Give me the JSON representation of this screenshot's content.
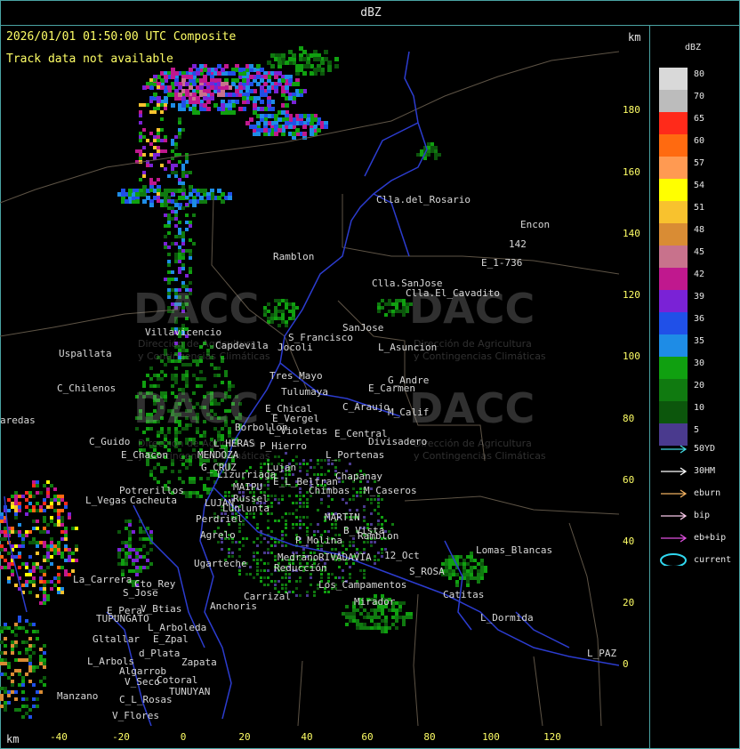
{
  "window": {
    "title": "dBZ"
  },
  "map": {
    "header": "2026/01/01 01:50:00 UTC Composite",
    "track_note": "Track data not available",
    "unit_top": "km",
    "unit_bottom": "km",
    "y_ticks": [
      "180",
      "160",
      "140",
      "120",
      "100",
      "80",
      "60",
      "40",
      "20",
      "0"
    ],
    "x_ticks": [
      "-40",
      "-20",
      "0",
      "20",
      "40",
      "60",
      "80",
      "100",
      "120"
    ],
    "places": [
      {
        "name": "Clla.del_Rosario"
      },
      {
        "name": "Encon"
      },
      {
        "name": "142"
      },
      {
        "name": "E_1-736"
      },
      {
        "name": "Ramblon"
      },
      {
        "name": "Clla.SanJose"
      },
      {
        "name": "Clla.El_Cavadito"
      },
      {
        "name": "SanJose"
      },
      {
        "name": "Villavicencio"
      },
      {
        "name": "Capdevila"
      },
      {
        "name": "S_Francisco"
      },
      {
        "name": "L_Asuncion"
      },
      {
        "name": "Uspallata"
      },
      {
        "name": "Jocoli"
      },
      {
        "name": "Tres_Mayo"
      },
      {
        "name": "G_Andre"
      },
      {
        "name": "C_Chilenos"
      },
      {
        "name": "Tulumaya"
      },
      {
        "name": "E_Carmen"
      },
      {
        "name": "E_Chical"
      },
      {
        "name": "C_Araujo"
      },
      {
        "name": "M_Calif"
      },
      {
        "name": "E_Vergel"
      },
      {
        "name": "aredas"
      },
      {
        "name": "Borbollon"
      },
      {
        "name": "L_Violetas"
      },
      {
        "name": "E_Central"
      },
      {
        "name": "Divisadero"
      },
      {
        "name": "C_Guido"
      },
      {
        "name": "L_HERAS"
      },
      {
        "name": "P_Hierro"
      },
      {
        "name": "E_Chacon"
      },
      {
        "name": "MENDOZA"
      },
      {
        "name": "L_Portenas"
      },
      {
        "name": "G_CRUZ"
      },
      {
        "name": "Lujan"
      },
      {
        "name": "Lizurriaga"
      },
      {
        "name": "Chapanay"
      },
      {
        "name": "E_L_Beltran"
      },
      {
        "name": "Chimbas"
      },
      {
        "name": "MAIPU"
      },
      {
        "name": "M_Caseros"
      },
      {
        "name": "Potrerillos"
      },
      {
        "name": "L_Vegas"
      },
      {
        "name": "Cacheuta"
      },
      {
        "name": "Russel"
      },
      {
        "name": "LUJAN"
      },
      {
        "name": "Lunlunta"
      },
      {
        "name": "MARTIN"
      },
      {
        "name": "Perdriel"
      },
      {
        "name": "B_Vista"
      },
      {
        "name": "Agrelo"
      },
      {
        "name": "Ramblon"
      },
      {
        "name": "P_Molina"
      },
      {
        "name": "Lomas_Blancas"
      },
      {
        "name": "Ugarteche"
      },
      {
        "name": "RIVADAVIA"
      },
      {
        "name": "12_Oct"
      },
      {
        "name": "Medrano"
      },
      {
        "name": "S_ROSA"
      },
      {
        "name": "Reducción"
      },
      {
        "name": "Catitas"
      },
      {
        "name": "La_Carrera"
      },
      {
        "name": "Cto_Rey"
      },
      {
        "name": "Los_Campamentos"
      },
      {
        "name": "S_Jose"
      },
      {
        "name": "Carrizal"
      },
      {
        "name": "Mirador"
      },
      {
        "name": "Anchoris"
      },
      {
        "name": "E_Pera"
      },
      {
        "name": "V_Btias"
      },
      {
        "name": "TUPUNGATO"
      },
      {
        "name": "L_Dormida"
      },
      {
        "name": "L_Arboleda"
      },
      {
        "name": "Gltallar"
      },
      {
        "name": "E_Zpal"
      },
      {
        "name": "L_PAZ"
      },
      {
        "name": "d_Plata"
      },
      {
        "name": "L_Arbols"
      },
      {
        "name": "Zapata"
      },
      {
        "name": "Algarrob"
      },
      {
        "name": "V_Seco"
      },
      {
        "name": "Cotoral"
      },
      {
        "name": "TUNUYAN"
      },
      {
        "name": "Manzano"
      },
      {
        "name": "C_L_Rosas"
      },
      {
        "name": "V_Flores"
      }
    ],
    "watermark": {
      "brand": "DACC",
      "line1": "Dirección de Agricultura",
      "line2": "y Contingencias Climáticas"
    }
  },
  "legend": {
    "title": "dBZ",
    "levels": [
      {
        "label": "80",
        "color": "#d9d9d9"
      },
      {
        "label": "70",
        "color": "#bcbcbc"
      },
      {
        "label": "65",
        "color": "#ff2a1a"
      },
      {
        "label": "60",
        "color": "#ff6a10"
      },
      {
        "label": "57",
        "color": "#ff9a52"
      },
      {
        "label": "54",
        "color": "#ffff00"
      },
      {
        "label": "51",
        "color": "#f8c22e"
      },
      {
        "label": "48",
        "color": "#d98c34"
      },
      {
        "label": "45",
        "color": "#c8728c"
      },
      {
        "label": "42",
        "color": "#c0188e"
      },
      {
        "label": "39",
        "color": "#7a22d6"
      },
      {
        "label": "36",
        "color": "#2050e8"
      },
      {
        "label": "35",
        "color": "#1e8ce6"
      },
      {
        "label": "30",
        "color": "#10a010"
      },
      {
        "label": "20",
        "color": "#107a10"
      },
      {
        "label": "10",
        "color": "#0c560c"
      },
      {
        "label": "5",
        "color": "#4a3a8e"
      }
    ],
    "tracks": [
      {
        "label": "50YD",
        "color": "#40d8e0"
      },
      {
        "label": "30HM",
        "color": "#ffffff"
      },
      {
        "label": "eburn",
        "color": "#f0b060"
      },
      {
        "label": "bip",
        "color": "#f8c8e8"
      },
      {
        "label": "eb+bip",
        "color": "#e050e0"
      },
      {
        "label": "current",
        "color": "#30d8f0"
      }
    ]
  }
}
